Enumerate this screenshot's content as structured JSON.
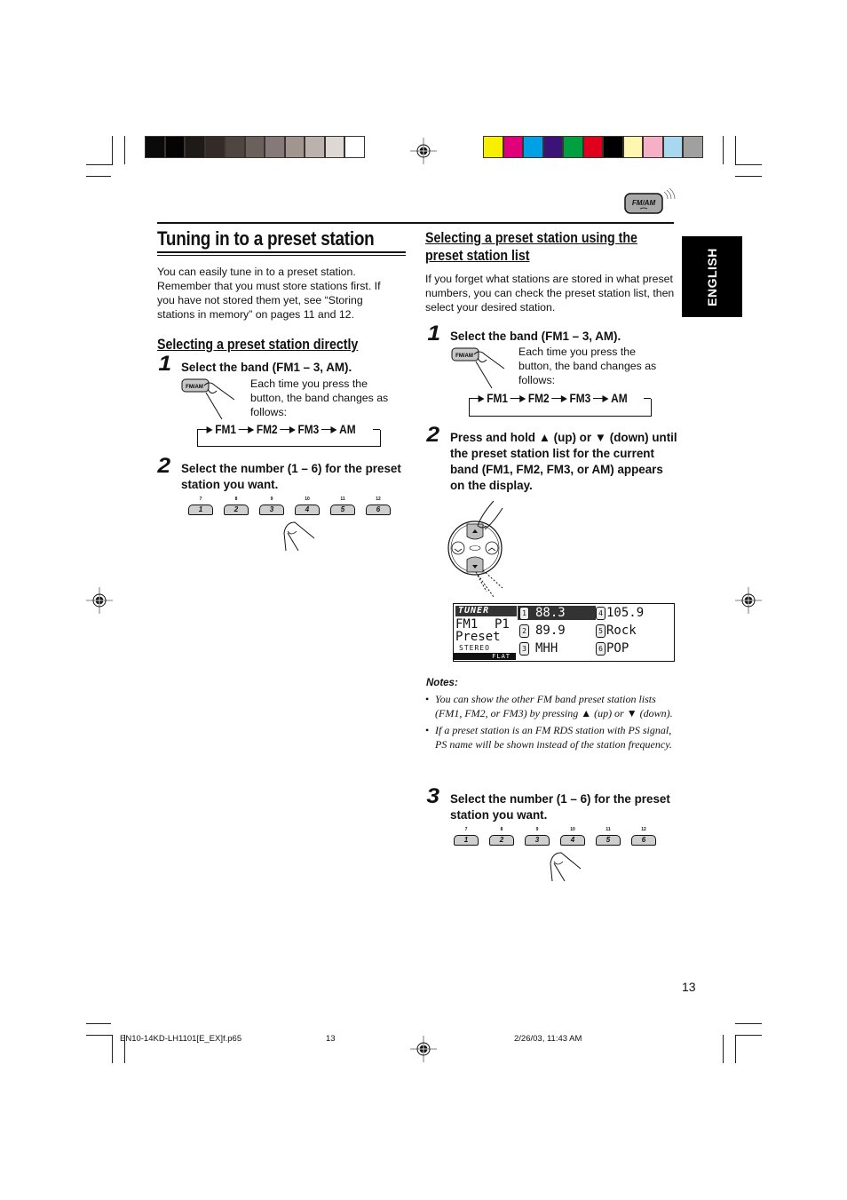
{
  "print_marks": {
    "gray_swatches": [
      "#0a0a0a",
      "#050303",
      "#1e1a17",
      "#342a27",
      "#4f4641",
      "#6a615c",
      "#85797a",
      "#a0958f",
      "#bcb2ad",
      "#ddd8d4",
      "#ffffff"
    ],
    "color_swatches": [
      "#f7ef00",
      "#e2007a",
      "#00a0e6",
      "#3b1278",
      "#00a040",
      "#e0001e",
      "#000000",
      "#fff7b0",
      "#f5b0c8",
      "#a8d8f0",
      "#a0a0a0"
    ]
  },
  "band_button_icon": {
    "label": "FM/AM"
  },
  "language_tab": {
    "label": "ENGLISH"
  },
  "left": {
    "title": "Tuning in to a preset station",
    "intro": "You can easily tune in to a preset station. Remember that you must store stations first. If you have not stored them yet, see “Storing stations in memory” on pages 11 and 12.",
    "section_title": "Selecting a preset station directly",
    "step1": {
      "num": "1",
      "text": "Select the band (FM1 – 3, AM).",
      "button_label": "FM/AM",
      "desc": "Each time you press the button, the band changes as follows:",
      "sequence": [
        "FM1",
        "FM2",
        "FM3",
        "AM"
      ]
    },
    "step2": {
      "num": "2",
      "text": "Select the number (1 – 6) for the preset station you want.",
      "preset_keys": [
        {
          "main": "1",
          "sub": "7"
        },
        {
          "main": "2",
          "sub": "8"
        },
        {
          "main": "3",
          "sub": "9"
        },
        {
          "main": "4",
          "sub": "10"
        },
        {
          "main": "5",
          "sub": "11"
        },
        {
          "main": "6",
          "sub": "12"
        }
      ]
    }
  },
  "right": {
    "section_title_line1": "Selecting a preset station using the",
    "section_title_line2": "preset station list",
    "intro": "If you forget what stations are stored in what preset numbers, you can check the preset station list, then select your desired station.",
    "step1": {
      "num": "1",
      "text": "Select the band (FM1 – 3, AM).",
      "button_label": "FM/AM",
      "desc": "Each time you press the button, the band changes as follows:",
      "sequence": [
        "FM1",
        "FM2",
        "FM3",
        "AM"
      ]
    },
    "step2": {
      "num": "2",
      "text": "Press and hold ▲ (up) or ▼ (down) until the preset station list for the current band (FM1, FM2, FM3, or AM) appears on the display."
    },
    "display": {
      "source": "TUNER",
      "band": "FM1",
      "preset": "P1",
      "mode": "Preset",
      "stereo": "STEREO",
      "eq": "FLAT",
      "stations": [
        {
          "num": "1",
          "name": "88.3"
        },
        {
          "num": "2",
          "name": "89.9"
        },
        {
          "num": "3",
          "name": "MHH"
        },
        {
          "num": "4",
          "name": "105.9"
        },
        {
          "num": "5",
          "name": "Rock"
        },
        {
          "num": "6",
          "name": "POP"
        }
      ]
    },
    "notes": {
      "heading": "Notes:",
      "items": [
        "You can show the other FM band preset station lists (FM1, FM2, or FM3) by pressing ▲ (up) or ▼ (down).",
        "If a preset station is an FM RDS station with PS signal, PS name will be shown instead of the station frequency."
      ]
    },
    "step3": {
      "num": "3",
      "text": "Select the number (1 – 6) for the preset station you want.",
      "preset_keys": [
        {
          "main": "1",
          "sub": "7"
        },
        {
          "main": "2",
          "sub": "8"
        },
        {
          "main": "3",
          "sub": "9"
        },
        {
          "main": "4",
          "sub": "10"
        },
        {
          "main": "5",
          "sub": "11"
        },
        {
          "main": "6",
          "sub": "12"
        }
      ]
    }
  },
  "page_number": "13",
  "footer": {
    "file": "EN10-14KD-LH1101[E_EX]f.p65",
    "page": "13",
    "date": "2/26/03, 11:43 AM"
  }
}
